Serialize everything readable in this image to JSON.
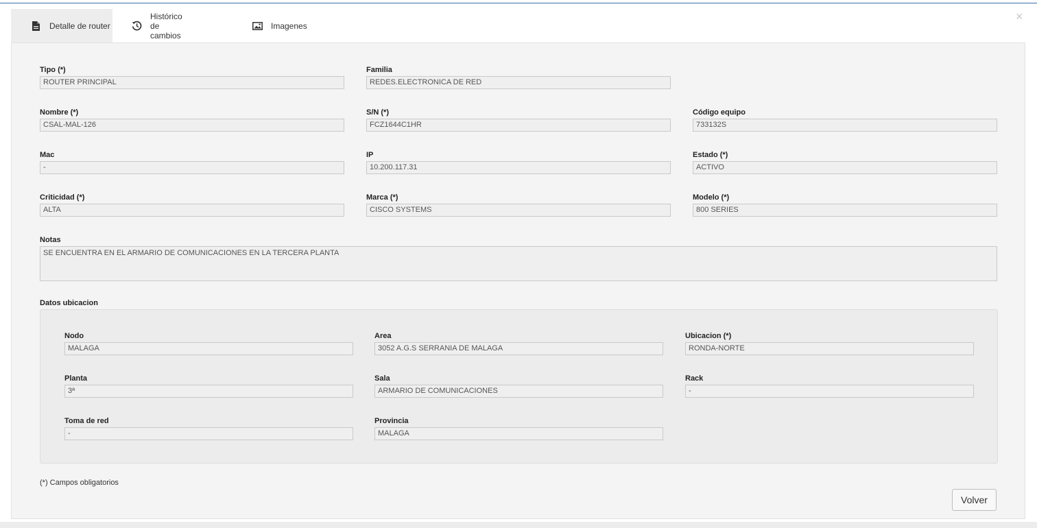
{
  "close_glyph": "×",
  "tabs": [
    {
      "label": "Detalle de router",
      "icon": "document-icon",
      "active": true
    },
    {
      "label": "Histórico de cambios",
      "icon": "history-icon",
      "active": false
    },
    {
      "label": "Imagenes",
      "icon": "image-icon",
      "active": false
    }
  ],
  "fields": {
    "tipo": {
      "label": "Tipo (*)",
      "value": "ROUTER PRINCIPAL"
    },
    "familia": {
      "label": "Familia",
      "value": "REDES.ELECTRONICA DE RED"
    },
    "nombre": {
      "label": "Nombre (*)",
      "value": "CSAL-MAL-126"
    },
    "sn": {
      "label": "S/N (*)",
      "value": "FCZ1644C1HR"
    },
    "codigo": {
      "label": "Código equipo",
      "value": "733132S"
    },
    "mac": {
      "label": "Mac",
      "value": "-"
    },
    "ip": {
      "label": "IP",
      "value": "10.200.117.31"
    },
    "estado": {
      "label": "Estado (*)",
      "value": "ACTIVO"
    },
    "criticidad": {
      "label": "Criticidad (*)",
      "value": "ALTA"
    },
    "marca": {
      "label": "Marca (*)",
      "value": "CISCO SYSTEMS"
    },
    "modelo": {
      "label": "Modelo (*)",
      "value": "800 SERIES"
    },
    "notas": {
      "label": "Notas",
      "value": "SE ENCUENTRA EN EL ARMARIO DE COMUNICACIONES EN LA TERCERA PLANTA"
    }
  },
  "ubicacion": {
    "title": "Datos ubicacion",
    "nodo": {
      "label": "Nodo",
      "value": "MALAGA"
    },
    "area": {
      "label": "Area",
      "value": "3052 A.G.S SERRANIA DE MALAGA"
    },
    "ubicacion": {
      "label": "Ubicacion (*)",
      "value": "RONDA-NORTE"
    },
    "planta": {
      "label": "Planta",
      "value": "3ª"
    },
    "sala": {
      "label": "Sala",
      "value": "ARMARIO DE COMUNICACIONES"
    },
    "rack": {
      "label": "Rack",
      "value": "-"
    },
    "toma": {
      "label": "Toma de red",
      "value": "-"
    },
    "provincia": {
      "label": "Provincia",
      "value": "MALAGA"
    }
  },
  "footer": {
    "required_note": "(*) Campos obligatorios",
    "back_button": "Volver"
  }
}
